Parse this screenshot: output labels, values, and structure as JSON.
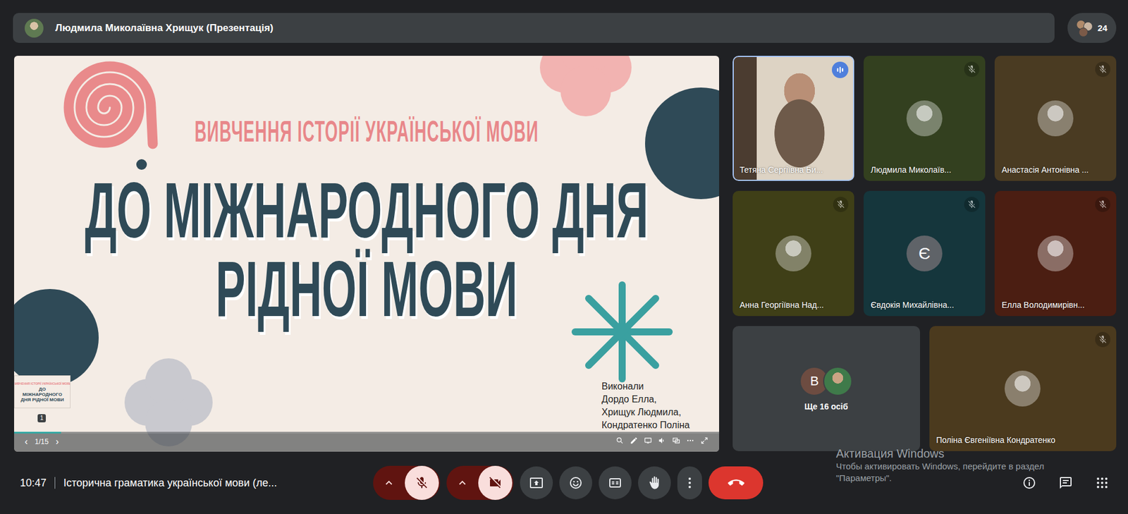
{
  "top_bar": {
    "presenter": "Людмила Миколаївна Хрищук (Презентація)",
    "participant_count": "24"
  },
  "slide": {
    "subtitle": "ВИВЧЕННЯ ІСТОРІЇ УКРАЇНСЬКОЇ МОВИ",
    "title_lines": [
      "ДО МІЖНАРОДНОГО ДНЯ",
      "РІДНОЇ МОВИ"
    ],
    "authors": [
      "Виконали",
      "Дордо Елла,",
      "Хрищук Людмила,",
      "Кондратенко Поліна"
    ],
    "thumbnail": {
      "subtitle": "ВИВЧЕННЯ ІСТОРІЇ УКРАЇНСЬКОЇ МОВИ",
      "title": "ДО МІЖНАРОДНОГО ДНЯ РІДНОЇ МОВИ",
      "number": "1"
    },
    "pager": {
      "prev": "‹",
      "page": "1/15",
      "next": "›"
    },
    "progress": {
      "level": 0.067
    }
  },
  "tiles": [
    {
      "name": "Тетяна Сергіївна Би...",
      "kind": "video",
      "muted": false,
      "speaking": true,
      "color": "#6b5a48"
    },
    {
      "name": "Людмила Миколаїв...",
      "kind": "photo",
      "muted": true,
      "speaking": false,
      "color": "#33401f"
    },
    {
      "name": "Анастасія Антонівна ...",
      "kind": "photo",
      "muted": true,
      "speaking": false,
      "color": "#4a3b22"
    },
    {
      "name": "Анна Георгіївна Над...",
      "kind": "photo",
      "muted": true,
      "speaking": false,
      "color": "#3f3f17"
    },
    {
      "name": "Євдокія Михайлівна...",
      "kind": "letter",
      "letter": "Є",
      "muted": true,
      "speaking": false,
      "color": "#15363c"
    },
    {
      "name": "Елла Володимирівн...",
      "kind": "photo",
      "muted": true,
      "speaking": false,
      "color": "#4b1e12"
    },
    {
      "name": "Ще 16 осіб",
      "kind": "others",
      "letter": "В",
      "muted": false,
      "speaking": false,
      "color": "#3c4043"
    },
    {
      "name": "Поліна Євгеніївна Кондратенко",
      "kind": "photo",
      "muted": true,
      "speaking": false,
      "color": "#4b3a1e"
    }
  ],
  "meeting": {
    "time": "10:47",
    "title": "Історична граматика української мови (ле..."
  },
  "controls": [
    {
      "kind": "mic",
      "active": false
    },
    {
      "kind": "camera",
      "active": false
    },
    {
      "kind": "present"
    },
    {
      "kind": "emoji"
    },
    {
      "kind": "captions"
    },
    {
      "kind": "hand"
    },
    {
      "kind": "more"
    },
    {
      "kind": "leave"
    }
  ],
  "side_buttons": [
    {
      "kind": "info"
    },
    {
      "kind": "chat"
    },
    {
      "kind": "activities"
    }
  ],
  "watermark": {
    "title": "Активация Windows",
    "lines": [
      "Чтобы активировать Windows, перейдите в раздел",
      "\"Параметры\"."
    ]
  }
}
